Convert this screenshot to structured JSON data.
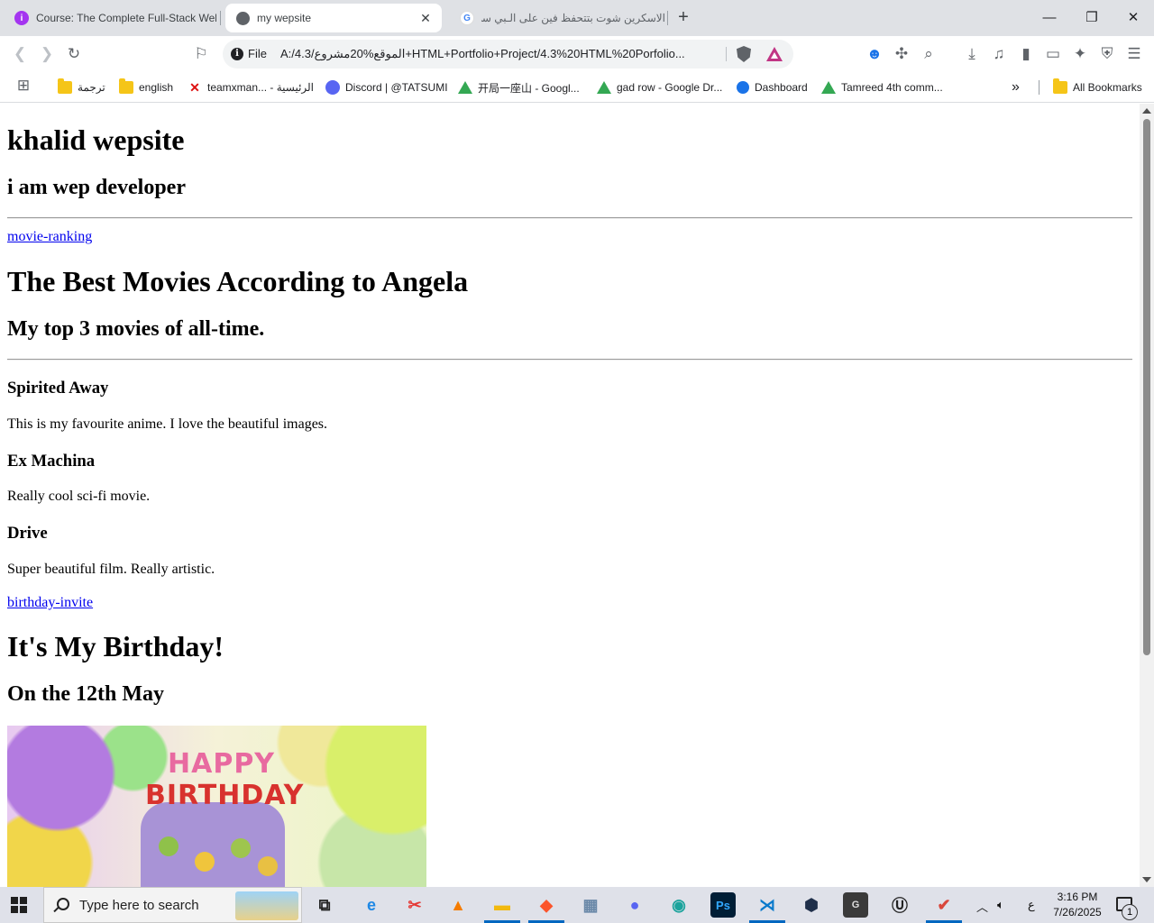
{
  "browser": {
    "tabs": [
      {
        "title": "Course: The Complete Full-Stack Web Development Bootcamp"
      },
      {
        "title": "my wepsite"
      },
      {
        "title": "الاسكرين شوت بتتحفظ فين على الـبي سي"
      }
    ],
    "new_tab_symbol": "+",
    "address": {
      "scheme_label": "File",
      "url": "A:/4.3/الموقع%20مشروع+HTML+Portfolio+Project/4.3%20HTML%20Porfolio..."
    },
    "bookmarks": [
      {
        "label": "ترجمة",
        "icon": "folder-icon"
      },
      {
        "label": "english",
        "icon": "folder-icon"
      },
      {
        "label": "teamxman... - الرئيسية",
        "icon": "x-logo-icon"
      },
      {
        "label": "Discord | @TATSUMI",
        "icon": "discord-icon"
      },
      {
        "label": "开局一座山 - Googl...",
        "icon": "drive-icon"
      },
      {
        "label": "gad row - Google Dr...",
        "icon": "drive-icon"
      },
      {
        "label": "Dashboard",
        "icon": "dashboard-icon"
      },
      {
        "label": "Tamreed 4th comm...",
        "icon": "drive-icon"
      }
    ],
    "all_bookmarks_label": "All Bookmarks",
    "overflow_symbol": "»"
  },
  "page": {
    "title": "khalid wepsite",
    "subtitle": "i am wep developer",
    "link_movie": "movie-ranking",
    "movies_heading": "The Best Movies According to Angela",
    "movies_subheading": "My top 3 movies of all-time.",
    "movies": [
      {
        "name": "Spirited Away",
        "desc": "This is my favourite anime. I love the beautiful images."
      },
      {
        "name": "Ex Machina",
        "desc": "Really cool sci-fi movie."
      },
      {
        "name": "Drive",
        "desc": "Super beautiful film. Really artistic."
      }
    ],
    "link_birthday": "birthday-invite",
    "birthday_heading": "It's My Birthday!",
    "birthday_date": "On the 12th May",
    "image_text": {
      "line1": "HAPPY",
      "line2": "BIRTHDAY"
    }
  },
  "taskbar": {
    "search_placeholder": "Type here to search",
    "ime_indicator": "ع",
    "time": "3:16 PM",
    "date": "7/26/2025",
    "notification_count": "1"
  },
  "colors": {
    "link": "#0000ee",
    "accent": "#0067c0",
    "brave": "#fb542b"
  }
}
